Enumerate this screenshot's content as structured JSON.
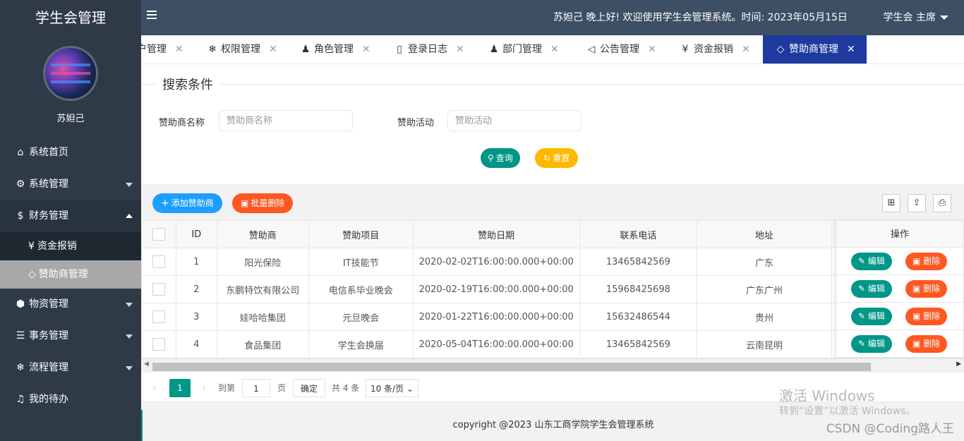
{
  "sidebar": {
    "app_title": "学生会管理",
    "username": "苏妲己",
    "menu": [
      {
        "label": "系统首页",
        "icon": "home-icon"
      },
      {
        "label": "系统管理",
        "icon": "gear-icon"
      },
      {
        "label": "财务管理",
        "icon": "dollar-icon"
      },
      {
        "label": "物资管理",
        "icon": "box-icon"
      },
      {
        "label": "事务管理",
        "icon": "sliders-icon"
      },
      {
        "label": "流程管理",
        "icon": "snowflake-icon"
      },
      {
        "label": "我的待办",
        "icon": "bell-icon"
      }
    ],
    "submenu": [
      {
        "label": "资金报销",
        "icon": "yen-icon"
      },
      {
        "label": "赞助商管理",
        "icon": "diamond-icon"
      }
    ]
  },
  "header": {
    "greeting": "苏妲己 晚上好!  欢迎使用学生会管理系统。时间:  2023年05月15日",
    "user_role": "学生会 主席"
  },
  "tabs": [
    {
      "label": "户管理"
    },
    {
      "label": "权限管理",
      "icon": "snowflake-icon"
    },
    {
      "label": "角色管理",
      "icon": "user-icon"
    },
    {
      "label": "登录日志",
      "icon": "file-icon"
    },
    {
      "label": "部门管理",
      "icon": "users-icon"
    },
    {
      "label": "公告管理",
      "icon": "speaker-icon"
    },
    {
      "label": "资金报销",
      "icon": "yen-icon"
    },
    {
      "label": "赞助商管理",
      "icon": "diamond-icon"
    }
  ],
  "search": {
    "legend": "搜索条件",
    "sponsor_name_label": "赞助商名称",
    "sponsor_name_placeholder": "赞助商名称",
    "activity_label": "赞助活动",
    "activity_placeholder": "赞助活动",
    "query_label": "查询",
    "reset_label": "重置"
  },
  "toolbar": {
    "add_label": "添加赞助商",
    "batch_delete_label": "批量删除"
  },
  "table": {
    "columns": [
      "ID",
      "赞助商",
      "赞助项目",
      "赞助日期",
      "联系电话",
      "地址"
    ],
    "ops_header": "操作",
    "edit_label": "编辑",
    "delete_label": "删除",
    "rows": [
      [
        "1",
        "阳光保险",
        "IT技能节",
        "2020-02-02T16:00:00.000+00:00",
        "13465842569",
        "广东"
      ],
      [
        "2",
        "东鹏特饮有限公司",
        "电信系毕业晚会",
        "2020-02-19T16:00:00.000+00:00",
        "15968425698",
        "广东广州"
      ],
      [
        "3",
        "娃哈哈集团",
        "元旦晚会",
        "2020-01-22T16:00:00.000+00:00",
        "15632486544",
        "贵州"
      ],
      [
        "4",
        "食品集团",
        "学生会换届",
        "2020-05-04T16:00:00.000+00:00",
        "13465842569",
        "云南昆明"
      ]
    ]
  },
  "pager": {
    "current": "1",
    "goto_label": "到第",
    "goto_value": "1",
    "page_unit": "页",
    "confirm_label": "确定",
    "total_label": "共 4 条",
    "page_size": "10 条/页"
  },
  "footer": "copyright @2023 山东工商学院学生会管理系统",
  "watermark": {
    "line1": "激活 Windows",
    "line2": "转到“设置”以激活 Windows。",
    "csdn": "CSDN @Coding路人王"
  },
  "colors": {
    "sidebar": "#2f3a47",
    "header": "#3e4e63",
    "active_tab": "#1e3a9f",
    "teal": "#009688",
    "orange": "#ff5722",
    "yellow": "#ffb800",
    "blue": "#1e9fff"
  }
}
